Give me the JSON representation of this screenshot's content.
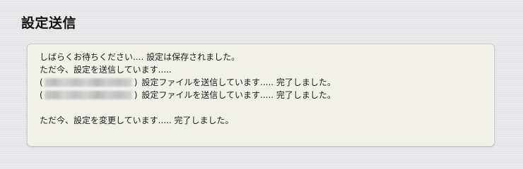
{
  "page": {
    "title": "設定送信"
  },
  "messages": {
    "wait_saved": "しばらくお待ちください.... 設定は保存されました。",
    "sending_settings": "ただ今、設定を送信しています.....",
    "devices": [
      {
        "open_paren": "(",
        "close_paren": ")",
        "status": "設定ファイルを送信しています..... 完了しました。"
      },
      {
        "open_paren": "(",
        "close_paren": ")",
        "status": "設定ファイルを送信しています..... 完了しました。"
      }
    ],
    "changing_settings": "ただ今、設定を変更しています..... 完了しました。"
  }
}
